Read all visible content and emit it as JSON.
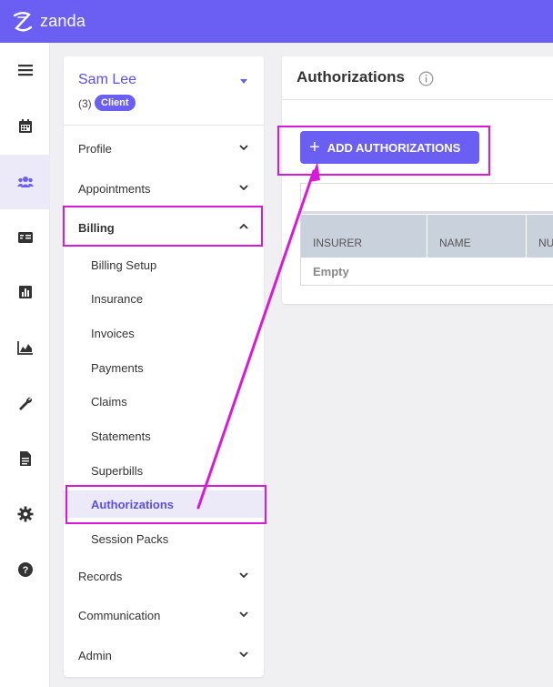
{
  "app": {
    "brand": "zanda",
    "accent": "#6b5ef3",
    "annotation_color": "#d81ad8"
  },
  "rail": [
    {
      "icon": "menu-icon"
    },
    {
      "icon": "calendar-icon"
    },
    {
      "icon": "users-icon",
      "active": true
    },
    {
      "icon": "id-card-icon"
    },
    {
      "icon": "bar-chart-icon"
    },
    {
      "icon": "area-chart-icon"
    },
    {
      "icon": "wrench-icon"
    },
    {
      "icon": "document-icon"
    },
    {
      "icon": "gear-icon"
    },
    {
      "icon": "help-icon"
    }
  ],
  "client": {
    "name": "Sam Lee",
    "count": "(3)",
    "badge": "Client"
  },
  "nav": {
    "profile": "Profile",
    "appointments": "Appointments",
    "billing": "Billing",
    "billing_items": [
      "Billing Setup",
      "Insurance",
      "Invoices",
      "Payments",
      "Claims",
      "Statements",
      "Superbills",
      "Authorizations",
      "Session Packs"
    ],
    "records": "Records",
    "communication": "Communication",
    "admin": "Admin"
  },
  "main": {
    "title": "Authorizations",
    "add_button": "ADD AUTHORIZATIONS",
    "columns": [
      "INSURER",
      "NAME",
      "NU"
    ],
    "empty_text": "Empty"
  }
}
